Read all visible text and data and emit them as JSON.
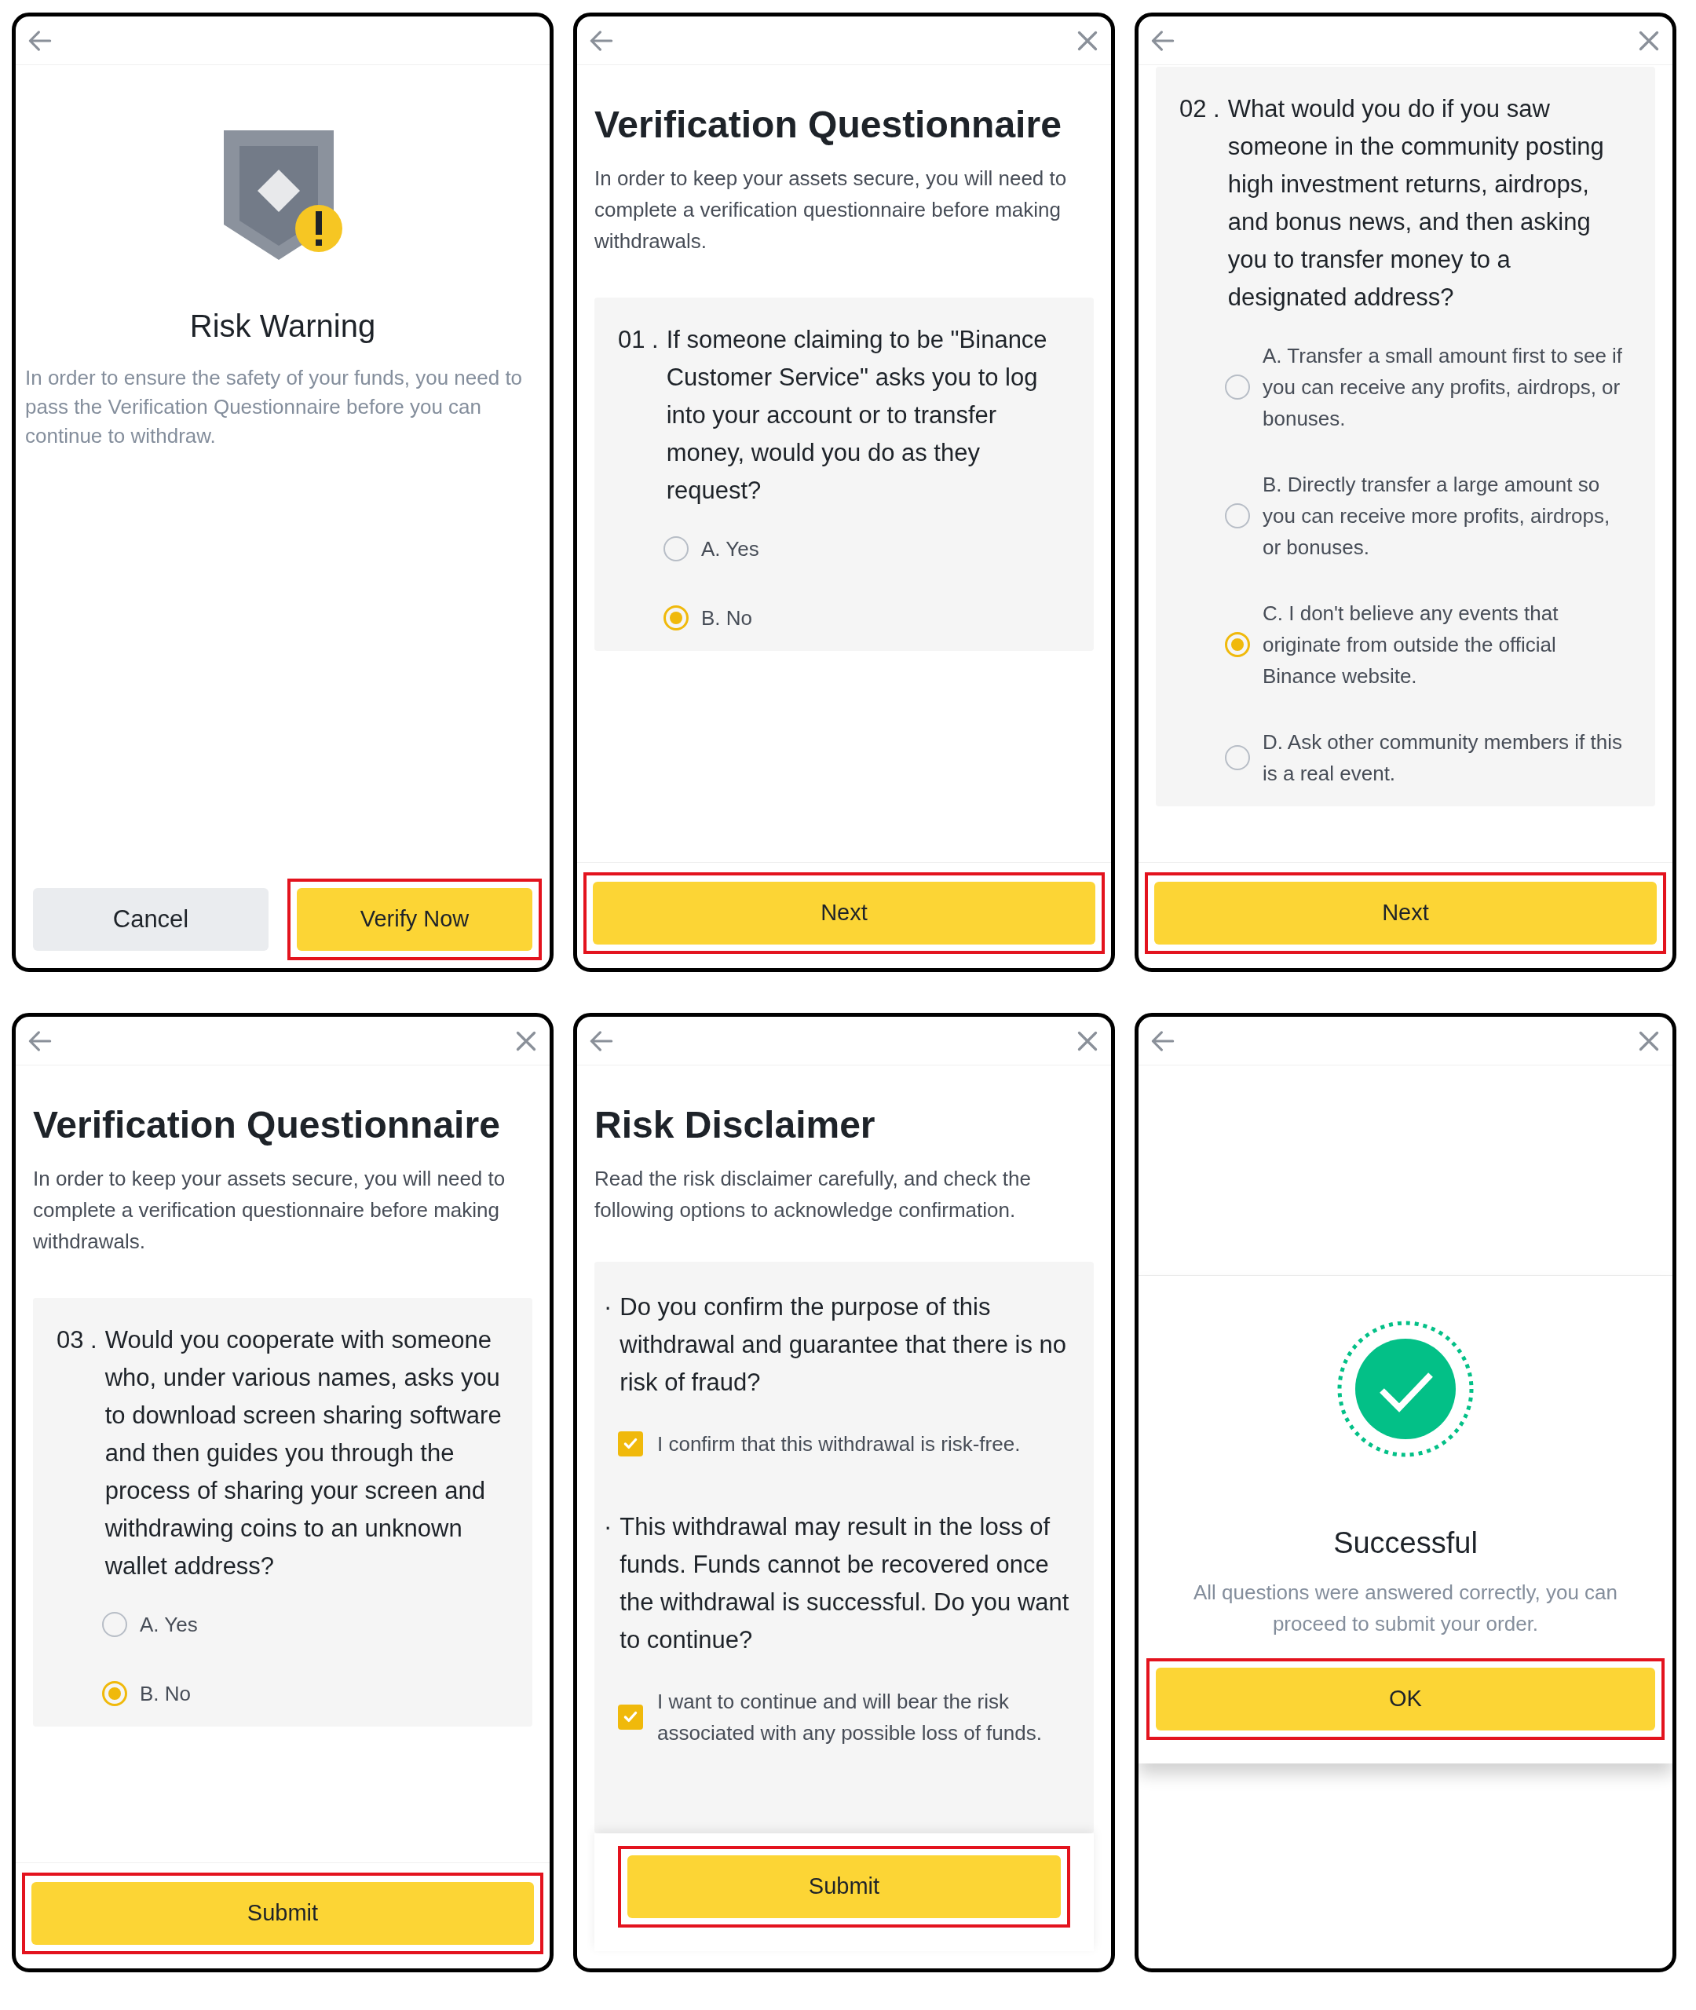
{
  "panels": [
    {
      "kind": "warning",
      "close_button": false,
      "title": "Risk Warning",
      "text": "In order to ensure the safety of your funds, you need to pass the Verification Questionnaire before you can continue to withdraw.",
      "buttons": [
        {
          "label": "Cancel",
          "kind": "secondary",
          "highlighted": false
        },
        {
          "label": "Verify Now",
          "kind": "primary",
          "highlighted": true
        }
      ]
    },
    {
      "kind": "question",
      "close_button": true,
      "title": "Verification Questionnaire",
      "intro": "In order to keep your assets secure, you will need to complete a verification questionnaire before making withdrawals.",
      "number": "01 .",
      "question": "If someone claiming to be \"Binance Customer Service\" asks you to log into your account or to transfer money, would you do as they request?",
      "options": [
        {
          "label": "A. Yes",
          "selected": false
        },
        {
          "label": "B. No",
          "selected": true
        }
      ],
      "buttons": [
        {
          "label": "Next",
          "kind": "primary",
          "highlighted": true
        }
      ]
    },
    {
      "kind": "question",
      "close_button": true,
      "number": "02 .",
      "question": "What would you do if you saw someone in the community posting high investment returns, airdrops, and bonus news, and then asking you to transfer money to a designated address?",
      "options": [
        {
          "label": "A. Transfer a small amount first to see if you can receive any profits, airdrops, or bonuses.",
          "selected": false
        },
        {
          "label": "B. Directly transfer a large amount so you can receive more profits, airdrops, or bonuses.",
          "selected": false
        },
        {
          "label": "C. I don't believe any events that originate from outside the official Binance website.",
          "selected": true
        },
        {
          "label": "D. Ask other community members if this is a real event.",
          "selected": false
        }
      ],
      "buttons": [
        {
          "label": "Next",
          "kind": "primary",
          "highlighted": true
        }
      ]
    },
    {
      "kind": "question",
      "close_button": true,
      "title": "Verification Questionnaire",
      "intro": "In order to keep your assets secure, you will need to complete a verification questionnaire before making withdrawals.",
      "number": "03 .",
      "question": "Would you cooperate with someone who, under various names, asks you to download screen sharing software and then guides you through the process of sharing your screen and withdrawing coins to an unknown wallet address?",
      "options": [
        {
          "label": "A. Yes",
          "selected": false
        },
        {
          "label": "B. No",
          "selected": true
        }
      ],
      "buttons": [
        {
          "label": "Submit",
          "kind": "primary",
          "highlighted": true
        }
      ]
    },
    {
      "kind": "disclaimer",
      "close_button": true,
      "title": "Risk Disclaimer",
      "intro": "Read the risk disclaimer carefully, and check the following options to acknowledge confirmation.",
      "items": [
        {
          "bullet": "·",
          "text": "Do you confirm the purpose of this withdrawal and guarantee that there is no risk of fraud?",
          "confirm_text": "I confirm that this withdrawal is risk-free.",
          "checked": true
        },
        {
          "bullet": "·",
          "text": "This withdrawal may result in the loss of funds. Funds cannot be recovered once the withdrawal is successful. Do you want to continue?",
          "confirm_text": "I want to continue and will bear the risk associated with any possible loss of funds.",
          "checked": true
        }
      ],
      "buttons": [
        {
          "label": "Submit",
          "kind": "primary",
          "highlighted": true
        }
      ]
    },
    {
      "kind": "success",
      "close_button": true,
      "title": "Successful",
      "text": "All questions were answered correctly, you can proceed to submit your order.",
      "buttons": [
        {
          "label": "OK",
          "kind": "primary",
          "highlighted": true
        }
      ]
    }
  ]
}
